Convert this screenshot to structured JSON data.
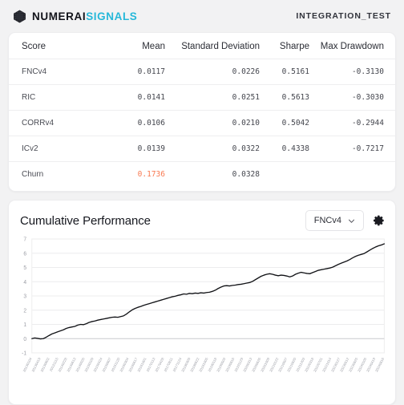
{
  "header": {
    "brand_primary": "NUMERAI",
    "brand_secondary": "SIGNALS",
    "brand_accent_color": "#26b8d9",
    "account": "INTEGRATION_TEST",
    "logo_icon": "numerai-cube-icon"
  },
  "scores_table": {
    "columns": [
      "Score",
      "Mean",
      "Standard Deviation",
      "Sharpe",
      "Max Drawdown"
    ],
    "highlight_color": "#f97a52",
    "rows": [
      {
        "score": "FNCv4",
        "mean": "0.0117",
        "sd": "0.0226",
        "sharpe": "0.5161",
        "max_drawdown": "-0.3130",
        "mean_highlight": false
      },
      {
        "score": "RIC",
        "mean": "0.0141",
        "sd": "0.0251",
        "sharpe": "0.5613",
        "max_drawdown": "-0.3030",
        "mean_highlight": false
      },
      {
        "score": "CORRv4",
        "mean": "0.0106",
        "sd": "0.0210",
        "sharpe": "0.5042",
        "max_drawdown": "-0.2944",
        "mean_highlight": false
      },
      {
        "score": "ICv2",
        "mean": "0.0139",
        "sd": "0.0322",
        "sharpe": "0.4338",
        "max_drawdown": "-0.7217",
        "mean_highlight": false
      },
      {
        "score": "Churn",
        "mean": "0.1736",
        "sd": "0.0328",
        "sharpe": "",
        "max_drawdown": "",
        "mean_highlight": true
      }
    ]
  },
  "chart_panel": {
    "title": "Cumulative Performance",
    "metric_select_value": "FNCv4",
    "metric_select_icon": "chevron-down-icon",
    "settings_icon": "gear-icon"
  },
  "chart_data": {
    "type": "line",
    "title": "Cumulative Performance",
    "xlabel": "",
    "ylabel": "",
    "ylim": [
      -1,
      7
    ],
    "yticks": [
      -1,
      0,
      1,
      2,
      3,
      4,
      5,
      6,
      7
    ],
    "grid": true,
    "legend": false,
    "series_name": "FNCv4",
    "series_color": "#111216",
    "x_tick_labels": [
      "20130104",
      "20130419",
      "20130802",
      "20131115",
      "20140228",
      "20140613",
      "20140926",
      "20150109",
      "20150424",
      "20150807",
      "20151120",
      "20160304",
      "20160617",
      "20161001",
      "20170113",
      "20170428",
      "20170811",
      "20171124",
      "20180309",
      "20180622",
      "20181005",
      "20190118",
      "20190503",
      "20190816",
      "20191129",
      "20200313",
      "20200626",
      "20201009",
      "20210122",
      "20210507",
      "20210820",
      "20211203",
      "20220318",
      "20220701",
      "20221014",
      "20230127",
      "20230512",
      "20230825",
      "20240105",
      "20240419",
      "20240816"
    ],
    "x": [
      0,
      1,
      2,
      3,
      4,
      5,
      6,
      7,
      8,
      9,
      10,
      11,
      12,
      13,
      14,
      15,
      16,
      17,
      18,
      19,
      20,
      21,
      22,
      23,
      24,
      25,
      26,
      27,
      28,
      29,
      30,
      31,
      32,
      33,
      34,
      35,
      36,
      37,
      38,
      39,
      40,
      41,
      42,
      43,
      44,
      45,
      46,
      47,
      48,
      49,
      50,
      51,
      52,
      53,
      54,
      55,
      56,
      57,
      58,
      59,
      60,
      61,
      62,
      63,
      64,
      65,
      66,
      67,
      68,
      69,
      70,
      71,
      72,
      73,
      74,
      75,
      76,
      77,
      78,
      79,
      80,
      81,
      82,
      83,
      84,
      85,
      86,
      87,
      88,
      89,
      90,
      91,
      92,
      93,
      94,
      95,
      96,
      97,
      98,
      99,
      100,
      101,
      102,
      103,
      104,
      105,
      106,
      107,
      108,
      109,
      110,
      111,
      112,
      113,
      114,
      115,
      116,
      117,
      118,
      119
    ],
    "values": [
      0.0,
      0.05,
      0.02,
      -0.02,
      0.0,
      0.1,
      0.22,
      0.33,
      0.4,
      0.48,
      0.55,
      0.62,
      0.72,
      0.78,
      0.82,
      0.86,
      0.95,
      1.0,
      0.98,
      1.05,
      1.14,
      1.2,
      1.24,
      1.3,
      1.34,
      1.38,
      1.42,
      1.46,
      1.5,
      1.52,
      1.5,
      1.55,
      1.6,
      1.72,
      1.88,
      2.02,
      2.12,
      2.2,
      2.26,
      2.34,
      2.4,
      2.46,
      2.52,
      2.58,
      2.64,
      2.7,
      2.76,
      2.82,
      2.88,
      2.94,
      2.98,
      3.04,
      3.08,
      3.14,
      3.12,
      3.18,
      3.16,
      3.2,
      3.18,
      3.22,
      3.2,
      3.24,
      3.26,
      3.32,
      3.4,
      3.52,
      3.62,
      3.7,
      3.72,
      3.7,
      3.74,
      3.76,
      3.8,
      3.82,
      3.86,
      3.9,
      3.94,
      4.02,
      4.14,
      4.26,
      4.38,
      4.46,
      4.52,
      4.56,
      4.52,
      4.46,
      4.42,
      4.46,
      4.44,
      4.4,
      4.34,
      4.4,
      4.52,
      4.6,
      4.66,
      4.62,
      4.58,
      4.56,
      4.64,
      4.72,
      4.8,
      4.84,
      4.88,
      4.92,
      4.96,
      5.02,
      5.12,
      5.22,
      5.3,
      5.38,
      5.46,
      5.56,
      5.68,
      5.78,
      5.86,
      5.92,
      5.98,
      6.1,
      6.22,
      6.34,
      6.44,
      6.52,
      6.58,
      6.66
    ]
  }
}
